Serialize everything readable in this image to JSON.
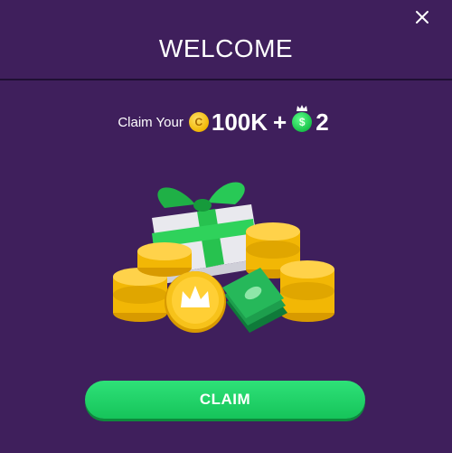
{
  "modal": {
    "title": "WELCOME",
    "close_icon": "close-icon"
  },
  "offer": {
    "prefix": "Claim Your",
    "coin_icon": "coin-icon",
    "coin_symbol": "C",
    "coin_amount": "100K",
    "separator": "+",
    "cash_icon": "cash-icon",
    "cash_symbol": "$",
    "cash_amount": "2"
  },
  "illustration": {
    "name": "gift-and-coins-illustration"
  },
  "claim_button": {
    "label": "CLAIM"
  },
  "colors": {
    "background": "#3f1f5c",
    "accent_green": "#1fd063",
    "coin_gold": "#f2b705"
  }
}
